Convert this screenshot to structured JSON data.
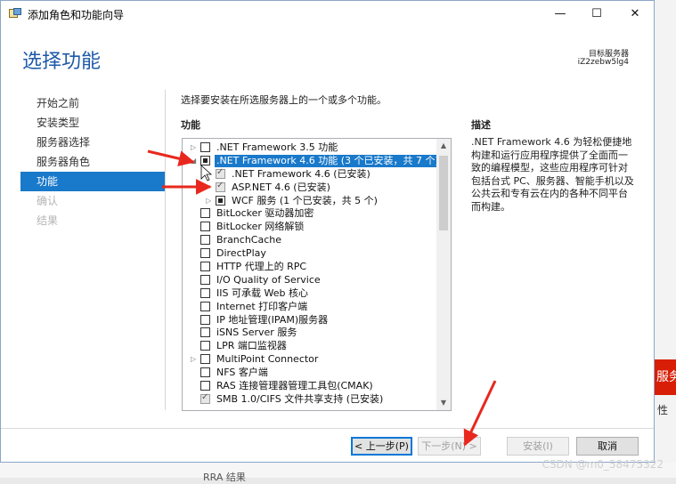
{
  "window": {
    "title": "添加角色和功能向导",
    "minimize_glyph": "—",
    "maximize_glyph": "☐",
    "close_glyph": "✕"
  },
  "header": {
    "title": "选择功能",
    "dest_server_label": "目标服务器",
    "dest_server_value": "iZ2zebw5lg4"
  },
  "steps": [
    {
      "label": "开始之前",
      "state": "normal"
    },
    {
      "label": "安装类型",
      "state": "normal"
    },
    {
      "label": "服务器选择",
      "state": "normal"
    },
    {
      "label": "服务器角色",
      "state": "normal"
    },
    {
      "label": "功能",
      "state": "active"
    },
    {
      "label": "确认",
      "state": "disabled"
    },
    {
      "label": "结果",
      "state": "disabled"
    }
  ],
  "content": {
    "instruction": "选择要安装在所选服务器上的一个或多个功能。",
    "features_label": "功能",
    "description_label": "描述",
    "description_text": ".NET Framework 4.6 为轻松便捷地构建和运行应用程序提供了全面而一致的编程模型，这些应用程序可针对包括台式 PC、服务器、智能手机以及公共云和专有云在内的各种不同平台而构建。"
  },
  "features": [
    {
      "label": ".NET Framework 3.5 功能",
      "level": 0,
      "expander": "▷",
      "check": "none",
      "selected": false
    },
    {
      "label": ".NET Framework 4.6 功能 (3 个已安装，共 7 个)",
      "level": 0,
      "expander": "◢",
      "check": "partial",
      "selected": true
    },
    {
      "label": ".NET Framework 4.6 (已安装)",
      "level": 1,
      "expander": "",
      "check": "checked",
      "selected": false
    },
    {
      "label": "ASP.NET 4.6 (已安装)",
      "level": 1,
      "expander": "",
      "check": "checked",
      "selected": false
    },
    {
      "label": "WCF 服务 (1 个已安装，共 5 个)",
      "level": 1,
      "expander": "▷",
      "check": "partial",
      "selected": false
    },
    {
      "label": "BitLocker 驱动器加密",
      "level": 0,
      "expander": "",
      "check": "none",
      "selected": false
    },
    {
      "label": "BitLocker 网络解锁",
      "level": 0,
      "expander": "",
      "check": "none",
      "selected": false
    },
    {
      "label": "BranchCache",
      "level": 0,
      "expander": "",
      "check": "none",
      "selected": false
    },
    {
      "label": "DirectPlay",
      "level": 0,
      "expander": "",
      "check": "none",
      "selected": false
    },
    {
      "label": "HTTP 代理上的 RPC",
      "level": 0,
      "expander": "",
      "check": "none",
      "selected": false
    },
    {
      "label": "I/O Quality of Service",
      "level": 0,
      "expander": "",
      "check": "none",
      "selected": false
    },
    {
      "label": "IIS 可承载 Web 核心",
      "level": 0,
      "expander": "",
      "check": "none",
      "selected": false
    },
    {
      "label": "Internet 打印客户端",
      "level": 0,
      "expander": "",
      "check": "none",
      "selected": false
    },
    {
      "label": "IP 地址管理(IPAM)服务器",
      "level": 0,
      "expander": "",
      "check": "none",
      "selected": false
    },
    {
      "label": "iSNS Server 服务",
      "level": 0,
      "expander": "",
      "check": "none",
      "selected": false
    },
    {
      "label": "LPR 端口监视器",
      "level": 0,
      "expander": "",
      "check": "none",
      "selected": false
    },
    {
      "label": "MultiPoint Connector",
      "level": 0,
      "expander": "▷",
      "check": "none",
      "selected": false
    },
    {
      "label": "NFS 客户端",
      "level": 0,
      "expander": "",
      "check": "none",
      "selected": false
    },
    {
      "label": "RAS 连接管理器管理工具包(CMAK)",
      "level": 0,
      "expander": "",
      "check": "none",
      "selected": false
    },
    {
      "label": "SMB 1.0/CIFS 文件共享支持 (已安装)",
      "level": 0,
      "expander": "",
      "check": "checked",
      "selected": false
    }
  ],
  "scrollbar": {
    "up": "▲",
    "down": "▼"
  },
  "buttons": {
    "prev": "< 上一步(P)",
    "next": "下一步(N) >",
    "install": "安装(I)",
    "cancel": "取消"
  },
  "background": {
    "watermark": "CSDN @m0_58475322",
    "red_box_text": "服务",
    "right_snippet": "性",
    "bottom_snippet": "RRA 结果"
  },
  "colors": {
    "accent": "#1979ca",
    "header_blue": "#1e5aa8",
    "annotation_red": "#e8281e"
  }
}
